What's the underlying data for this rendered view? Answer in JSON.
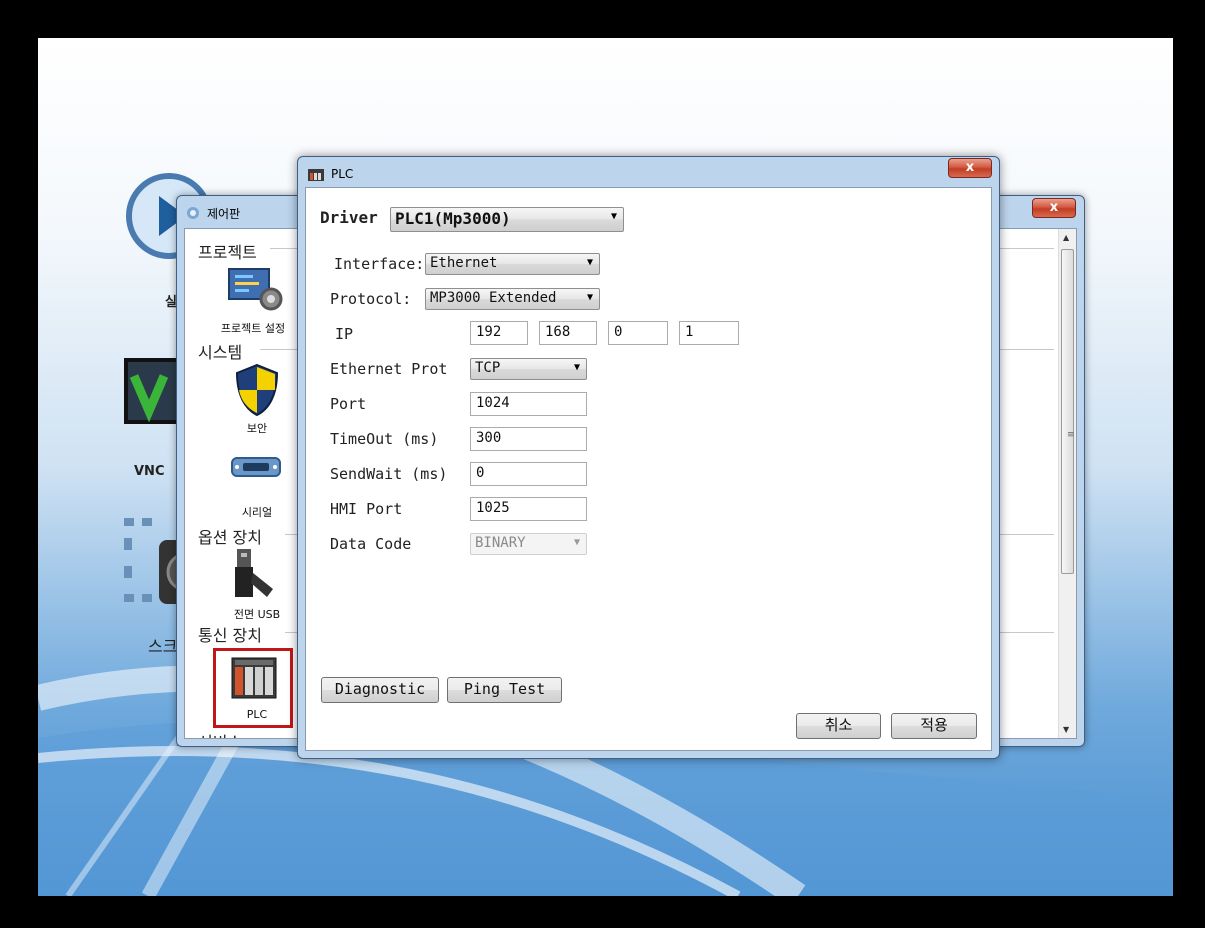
{
  "desktop": {
    "icon_labels": [
      "실",
      "VNC",
      "스크"
    ]
  },
  "control_panel": {
    "title": "제어판",
    "close_label": "x",
    "groups": [
      {
        "label": "프로젝트",
        "items": [
          {
            "label": "프로젝트 설정"
          }
        ]
      },
      {
        "label": "시스템",
        "items": [
          {
            "label": "보안"
          },
          {
            "label": "시리얼"
          }
        ]
      },
      {
        "label": "옵션 장치",
        "items": [
          {
            "label": "전면 USB"
          }
        ]
      },
      {
        "label": "통신 장치",
        "items": [
          {
            "label": "PLC"
          }
        ]
      },
      {
        "label": "서비스",
        "items": []
      }
    ]
  },
  "plc_dialog": {
    "title": "PLC",
    "close_label": "x",
    "driver_label": "Driver",
    "driver_value": "PLC1(Mp3000)",
    "interface_label": "Interface:",
    "interface_value": "Ethernet",
    "protocol_label": "Protocol:",
    "protocol_value": "MP3000 Extended",
    "ip_label": "IP",
    "ip": [
      "192",
      "168",
      "0",
      "1"
    ],
    "ethernet_protocol_label": "Ethernet Prot",
    "ethernet_protocol_value": "TCP",
    "port_label": "Port",
    "port_value": "1024",
    "timeout_label": "TimeOut (ms)",
    "timeout_value": "300",
    "sendwait_label": "SendWait (ms)",
    "sendwait_value": "0",
    "hmi_port_label": "HMI Port",
    "hmi_port_value": "1025",
    "data_code_label": "Data Code",
    "data_code_value": "BINARY",
    "diagnostic_label": "Diagnostic",
    "ping_test_label": "Ping Test",
    "cancel_label": "취소",
    "apply_label": "적용"
  },
  "colors": {
    "highlight": "#c01818",
    "title_bar": "#bcd4ec",
    "close_button": "#c23d25"
  }
}
